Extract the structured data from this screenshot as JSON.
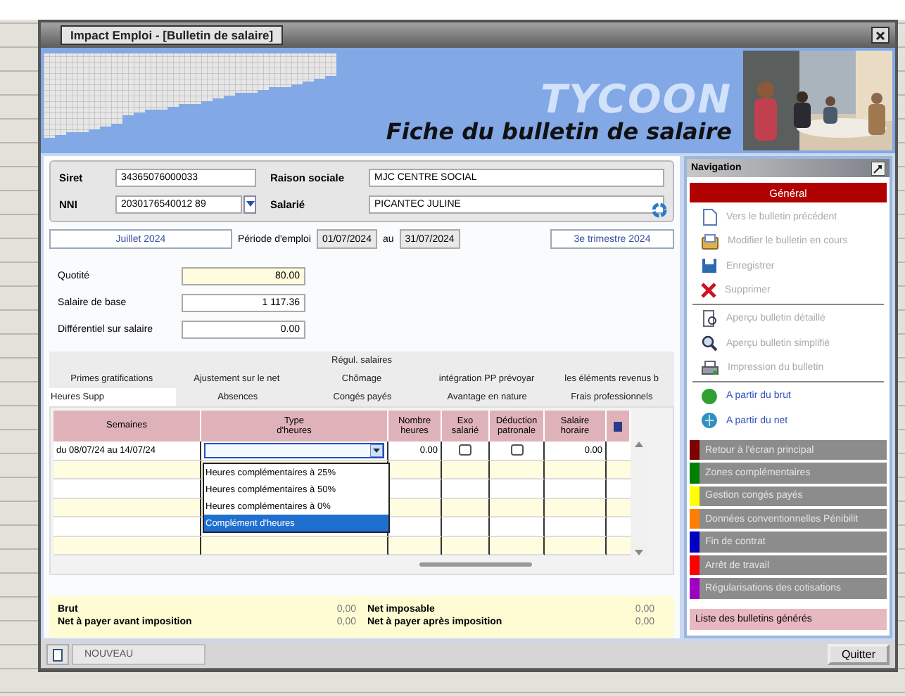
{
  "window": {
    "title": "Impact Emploi - [Bulletin de salaire]"
  },
  "banner": {
    "brand": "TYCOON",
    "title": "Fiche du bulletin de salaire"
  },
  "identity": [
    {
      "label": "Siret",
      "value": "34365076000033",
      "dropdown": false
    },
    {
      "label": "Raison sociale",
      "value": "MJC CENTRE SOCIAL",
      "dropdown": false
    },
    {
      "label": "NNI",
      "value": "2030176540012 89",
      "dropdown": true
    },
    {
      "label": "Salarié",
      "value": "PICANTEC JULINE",
      "dropdown": false
    }
  ],
  "period": {
    "month": "Juillet 2024",
    "label": "Période d'emploi",
    "start": "01/07/2024",
    "separator": "au",
    "end": "31/07/2024",
    "quarter": "3e trimestre 2024"
  },
  "amounts": [
    {
      "label": "Quotité",
      "value": "80.00",
      "highlighted": true
    },
    {
      "label": "Salaire de base",
      "value": "1 117.36",
      "highlighted": false
    },
    {
      "label": "Différentiel sur salaire",
      "value": "0.00",
      "highlighted": false
    }
  ],
  "tab_rows": [
    {
      "tabs": [
        {
          "label": "Régul. salaires",
          "selected": false
        }
      ]
    },
    {
      "tabs": [
        {
          "label": "Primes gratifications",
          "selected": false
        },
        {
          "label": "Ajustement sur le net",
          "selected": false
        },
        {
          "label": "Chômage",
          "selected": false
        },
        {
          "label": "intégration PP prévoyar",
          "selected": false
        },
        {
          "label": "les éléments revenus b",
          "selected": false
        }
      ]
    },
    {
      "tabs": [
        {
          "label": "Heures Supp",
          "selected": true
        },
        {
          "label": "Absences",
          "selected": false
        },
        {
          "label": "Congés payés",
          "selected": false
        },
        {
          "label": "Avantage en nature",
          "selected": false
        },
        {
          "label": "Frais professionnels",
          "selected": false
        }
      ]
    }
  ],
  "table": {
    "columns": [
      "Semaines",
      "Type\nd'heures",
      "Nombre\nheures",
      "Exo\nsalarié",
      "Déduction\npatronale",
      "Salaire\nhoraire"
    ],
    "rows": [
      {
        "week": "du 08/07/24 au 14/07/24",
        "type": {
          "expanded": true,
          "options": [
            {
              "label": "Heures complémentaires à 25%",
              "selected": false
            },
            {
              "label": "Heures complémentaires à 50%",
              "selected": false
            },
            {
              "label": "Heures complémentaires à 0%",
              "selected": false
            },
            {
              "label": "Complément d'heures",
              "selected": true
            }
          ]
        },
        "hours": "0.00",
        "exo": false,
        "deduction": false,
        "rate": "0.00"
      }
    ]
  },
  "totals": [
    {
      "label": "Brut",
      "value": "0,00"
    },
    {
      "label": "Net imposable",
      "value": "0,00"
    },
    {
      "label": "Net à payer avant imposition",
      "value": "0,00"
    },
    {
      "label": "Net à payer après imposition",
      "value": "0,00"
    }
  ],
  "navigation": {
    "title": "Navigation",
    "section": "Général",
    "action_groups": [
      {
        "items": [
          {
            "label": "Vers le bulletin précédent",
            "disabled": true
          },
          {
            "label": "Modifier le bulletin en cours",
            "disabled": true
          },
          {
            "label": "Enregistrer",
            "disabled": true
          },
          {
            "label": "Supprimer",
            "disabled": true
          }
        ]
      },
      {
        "items": [
          {
            "label": "Aperçu bulletin détaillé",
            "disabled": true
          },
          {
            "label": "Aperçu bulletin simplifié",
            "disabled": true
          },
          {
            "label": "Impression du bulletin",
            "disabled": true
          }
        ]
      },
      {
        "items": [
          {
            "label": "A partir du brut",
            "disabled": false
          },
          {
            "label": "A partir du net",
            "disabled": false
          }
        ]
      }
    ],
    "links": [
      {
        "label": "Retour à l'écran principal",
        "color": "#800000"
      },
      {
        "label": "Zones complémentaires",
        "color": "#008000"
      },
      {
        "label": "Gestion congés payés",
        "color": "#ffff00"
      },
      {
        "label": "Données conventionnelles Pénibilit",
        "color": "#ff8000"
      },
      {
        "label": "Fin de contrat",
        "color": "#0000c0"
      },
      {
        "label": "Arrêt de travail",
        "color": "#ff0000"
      },
      {
        "label": "Régularisations des cotisations",
        "color": "#a000c0"
      }
    ],
    "list_button": "Liste des bulletins générés"
  },
  "bottom_bar": {
    "tab": "NOUVEAU",
    "button": "Quitter"
  }
}
